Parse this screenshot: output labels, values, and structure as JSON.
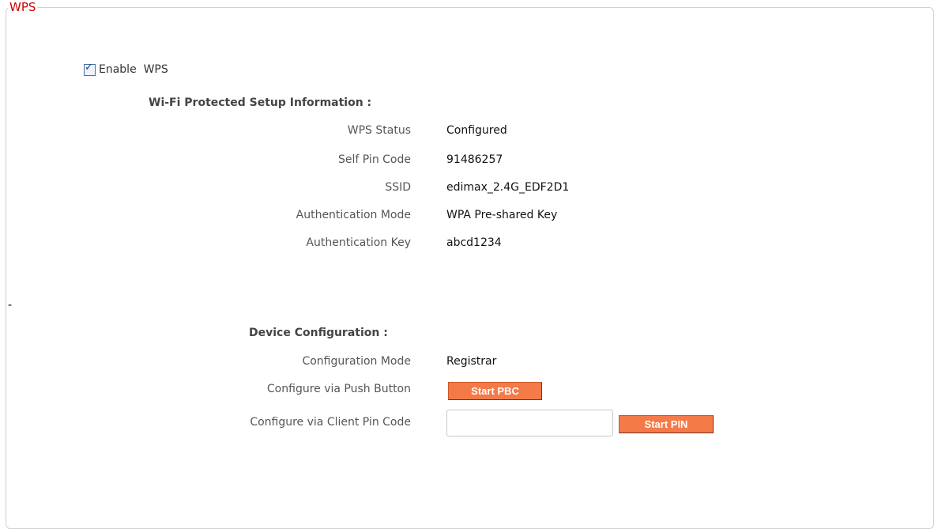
{
  "panel": {
    "title": "WPS"
  },
  "enable": {
    "label": "Enable  WPS",
    "checked": true
  },
  "info": {
    "heading": "Wi-Fi Protected Setup Information  :",
    "rows": [
      {
        "label": "WPS Status",
        "value": "Configured"
      },
      {
        "label": "Self Pin Code",
        "value": "91486257"
      },
      {
        "label": "SSID",
        "value": "edimax_2.4G_EDF2D1"
      },
      {
        "label": "Authentication Mode",
        "value": "WPA Pre-shared Key"
      },
      {
        "label": "Authentication Key",
        "value": "abcd1234"
      }
    ]
  },
  "separator": "-",
  "device": {
    "heading": "Device Configuration  :",
    "mode_label": "Configuration Mode",
    "mode_value": "Registrar",
    "push_label": "Configure via Push Button",
    "push_button": "Start PBC",
    "pin_label": "Configure via Client Pin Code",
    "pin_value": "",
    "pin_button": "Start PIN"
  },
  "colors": {
    "title": "#cc0000",
    "button": "#f47a48"
  }
}
